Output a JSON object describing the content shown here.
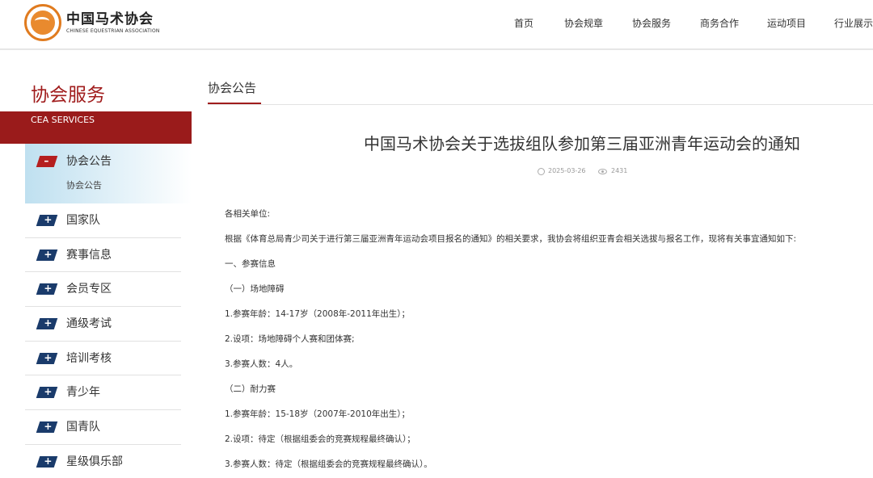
{
  "header": {
    "logo_cn": "中国马术协会",
    "logo_en": "CHINESE EQUESTRIAN ASSOCIATION",
    "nav": [
      "首页",
      "协会规章",
      "协会服务",
      "商务合作",
      "运动项目",
      "行业展示"
    ]
  },
  "sidebar": {
    "title": "协会服务",
    "subtitle": "CEA SERVICES",
    "active": {
      "label": "协会公告",
      "sublabel": "协会公告",
      "icon": "minus-flag-icon"
    },
    "items": [
      {
        "label": "国家队",
        "icon": "plus-flag-icon"
      },
      {
        "label": "赛事信息",
        "icon": "plus-flag-icon"
      },
      {
        "label": "会员专区",
        "icon": "plus-flag-icon"
      },
      {
        "label": "通级考试",
        "icon": "plus-flag-icon"
      },
      {
        "label": "培训考核",
        "icon": "plus-flag-icon"
      },
      {
        "label": "青少年",
        "icon": "plus-flag-icon"
      },
      {
        "label": "国青队",
        "icon": "plus-flag-icon"
      },
      {
        "label": "星级俱乐部",
        "icon": "plus-flag-icon"
      }
    ]
  },
  "main": {
    "section_title": "协会公告",
    "article": {
      "title": "中国马术协会关于选拔组队参加第三届亚洲青年运动会的通知",
      "date": "2025-03-26",
      "views": "2431",
      "paragraphs": [
        "各相关单位:",
        "根据《体育总局青少司关于进行第三届亚洲青年运动会项目报名的通知》的相关要求，我协会将组织亚青会相关选拔与报名工作，现将有关事宜通知如下:",
        "一、参赛信息",
        "（一）场地障碍",
        "1.参赛年龄：14-17岁（2008年-2011年出生）；",
        "2.设项：场地障碍个人赛和团体赛;",
        "3.参赛人数：4人。",
        "（二）耐力赛",
        "1.参赛年龄：15-18岁（2007年-2010年出生）；",
        "2.设项：待定（根据组委会的竞赛规程最终确认）；",
        "3.参赛人数：待定（根据组委会的竞赛规程最终确认）。"
      ]
    }
  },
  "colors": {
    "brand_red": "#9a1b1b",
    "nav_flag_blue": "#1a3b6b",
    "active_bg": "#bfe0f0"
  }
}
